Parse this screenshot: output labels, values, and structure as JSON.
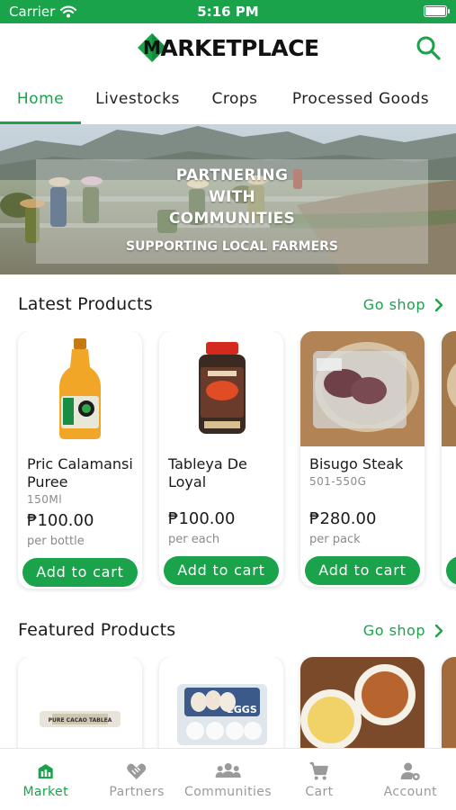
{
  "status_bar": {
    "carrier": "Carrier",
    "time": "5:16 PM"
  },
  "header": {
    "logo_letter": "M",
    "logo_text": "ARKETPLACE",
    "search_icon": "search-icon"
  },
  "tabs": [
    {
      "label": "Home",
      "active": true
    },
    {
      "label": "Livestocks",
      "active": false
    },
    {
      "label": "Crops",
      "active": false
    },
    {
      "label": "Processed Goods",
      "active": false
    }
  ],
  "banner": {
    "title": "PARTNERING\nWITH\nCOMMUNITIES",
    "subtitle": "SUPPORTING LOCAL FARMERS"
  },
  "latest_products": {
    "title": "Latest Products",
    "go_shop": "Go shop",
    "items": [
      {
        "name": "Pric Calamansi Puree",
        "size": "150Ml",
        "price": "₱100.00",
        "unit": "per bottle",
        "button": "Add to cart"
      },
      {
        "name": "Tableya De Loyal",
        "size": "",
        "price": "₱100.00",
        "unit": "per each",
        "button": "Add to cart"
      },
      {
        "name": "Bisugo Steak",
        "size": "501-550G",
        "price": "₱280.00",
        "unit": "per pack",
        "button": "Add to cart"
      }
    ]
  },
  "featured_products": {
    "title": "Featured Products",
    "go_shop": "Go shop",
    "product_image_labels": [
      "PURE CACAO TABLEA",
      "EGGS"
    ]
  },
  "bottom_nav": [
    {
      "label": "Market",
      "icon": "market-icon",
      "active": true
    },
    {
      "label": "Partners",
      "icon": "handshake-heart-icon",
      "active": false
    },
    {
      "label": "Communities",
      "icon": "people-icon",
      "active": false
    },
    {
      "label": "Cart",
      "icon": "cart-icon",
      "active": false
    },
    {
      "label": "Account",
      "icon": "account-gear-icon",
      "active": false
    }
  ],
  "colors": {
    "brand_green": "#1aa34a",
    "muted_gray": "#9a9a9a"
  }
}
